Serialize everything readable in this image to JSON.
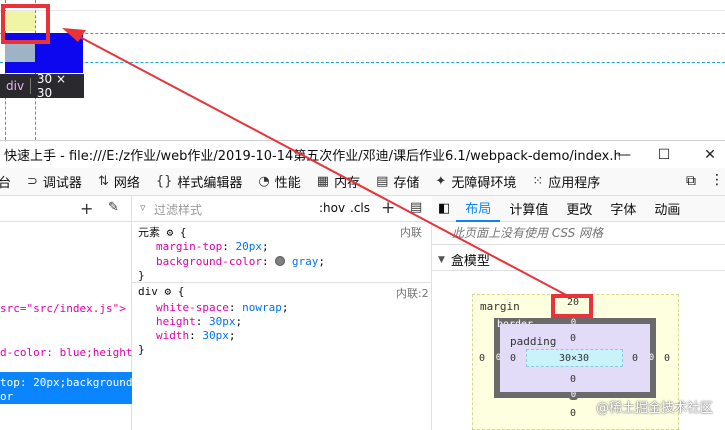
{
  "preview": {
    "tooltip_tag": "div",
    "tooltip_dims": "30 × 30"
  },
  "window": {
    "title": "快速上手 - file:///E:/z作业/web作业/2019-10-14第五次作业/邓迪/课后作业6.1/webpack-demo/index.html",
    "minimize": "—",
    "maximize": "☐",
    "close": "✕"
  },
  "toolbar": {
    "tabs": [
      {
        "label": "台",
        "icon": "inspector-icon"
      },
      {
        "label": "调试器",
        "icon": "debugger-icon"
      },
      {
        "label": "网络",
        "icon": "network-icon"
      },
      {
        "label": "样式编辑器",
        "icon": "style-editor-icon"
      },
      {
        "label": "性能",
        "icon": "performance-icon"
      },
      {
        "label": "内存",
        "icon": "memory-icon"
      },
      {
        "label": "存储",
        "icon": "storage-icon"
      },
      {
        "label": "无障碍环境",
        "icon": "accessibility-icon"
      },
      {
        "label": "应用程序",
        "icon": "application-icon"
      }
    ]
  },
  "markup": {
    "lines": [
      "src=\"src/index.js\">",
      "d-color: blue;height:",
      "top: 20px;background-",
      "or"
    ]
  },
  "rules": {
    "filter_placeholder": "过滤样式",
    "hov": ":hov",
    "cls": ".cls",
    "element_rule": {
      "selector": "元素",
      "source": "内联",
      "props": [
        {
          "name": "margin-top",
          "value": "20px"
        },
        {
          "name": "background-color",
          "value": "gray"
        }
      ]
    },
    "div_rule": {
      "selector": "div",
      "source": "内联:2",
      "props": [
        {
          "name": "white-space",
          "value": "nowrap"
        },
        {
          "name": "height",
          "value": "30px"
        },
        {
          "name": "width",
          "value": "30px"
        }
      ]
    }
  },
  "layout": {
    "tabs": [
      "布局",
      "计算值",
      "更改",
      "字体",
      "动画"
    ],
    "grid_notice": "此页面上没有使用 CSS 网格",
    "box_model_title": "盒模型",
    "box": {
      "margin_label": "margin",
      "margin_top": "20",
      "margin_left": "0",
      "margin_right": "0",
      "margin_bottom": "0",
      "border_label": "border",
      "border_top": "0",
      "border_left": "0",
      "border_right": "0",
      "border_bottom": "0",
      "padding_label": "padding",
      "padding_top": "0",
      "padding_left": "0",
      "padding_right": "0",
      "padding_bottom": "0",
      "content_size": "30×30"
    }
  },
  "watermark": "@稀土掘金技术社区",
  "colors": {
    "highlight_red": "#e8333a",
    "accent_blue": "#0a84ff",
    "element_blue": "#0d07f0"
  }
}
